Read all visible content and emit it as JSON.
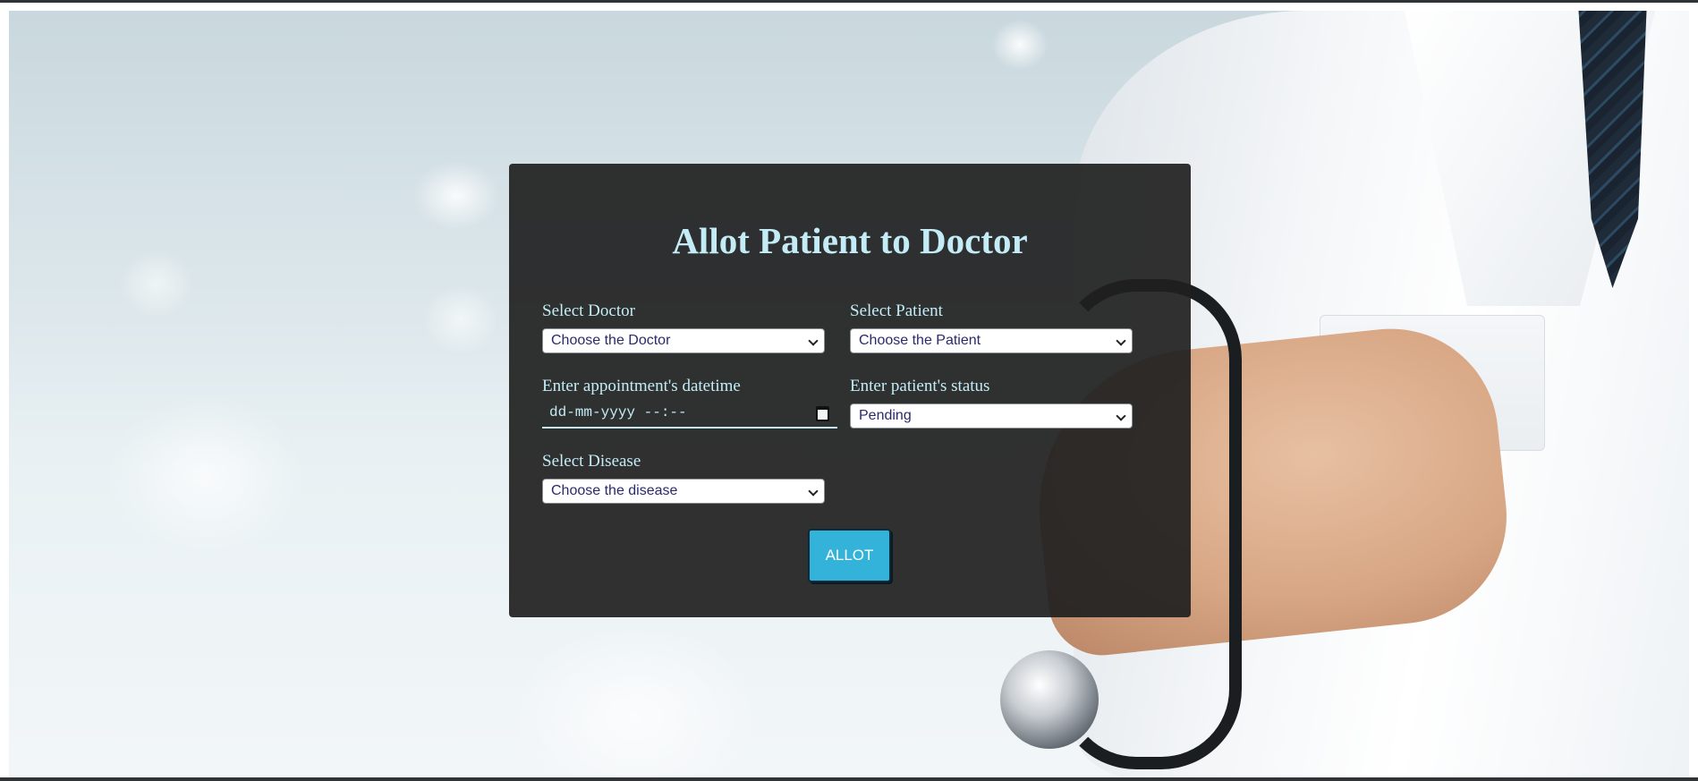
{
  "form": {
    "title": "Allot Patient to Doctor",
    "doctor": {
      "label": "Select Doctor",
      "value": "Choose the Doctor"
    },
    "patient": {
      "label": "Select Patient",
      "value": "Choose the Patient"
    },
    "datetime": {
      "label": "Enter appointment's datetime",
      "placeholder": "dd-mm-yyyy --:--"
    },
    "status": {
      "label": "Enter patient's status",
      "value": "Pending"
    },
    "disease": {
      "label": "Select Disease",
      "value": "Choose the disease"
    },
    "submit_label": "ALLOT"
  },
  "colors": {
    "label_text": "#c3ecf7",
    "panel_bg": "#1f1f1f",
    "button_bg": "#33b3d9",
    "select_text": "#2a2a6a"
  },
  "icons": {
    "select_caret": "chevron-down-icon",
    "datetime_picker": "calendar-icon"
  }
}
